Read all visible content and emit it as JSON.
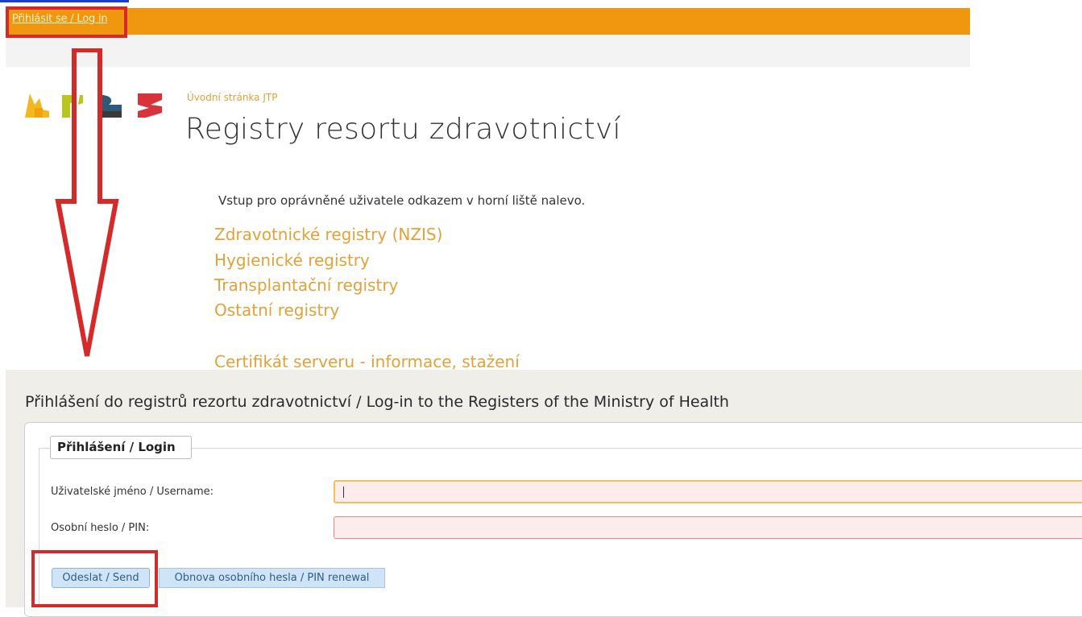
{
  "header": {
    "login_link": "Přihlásit se / Log in"
  },
  "breadcrumb": "Úvodní stránka JTP",
  "page_title": "Registry resortu zdravotnictví",
  "intro_text": "Vstup pro oprávněné uživatele odkazem v horní liště nalevo.",
  "registry_links": [
    "Zdravotnické registry (NZIS)",
    "Hygienické registry",
    "Transplantační registry",
    "Ostatní registry"
  ],
  "certificate_link": "Certifikát serveru - informace, stažení",
  "login_form": {
    "title": "Přihlášení do registrů rezortu zdravotnictví / Log-in to the Registers of the Ministry of Health",
    "legend": "Přihlášení / Login",
    "username_label": "Uživatelské jméno / Username:",
    "username_value": "",
    "pin_label": "Osobní heslo / PIN:",
    "pin_value": "",
    "send_button": "Odeslat / Send",
    "pin_renewal_button": "Obnova osobního hesla / PIN renewal"
  },
  "colors": {
    "topbar": "#f0960f",
    "link": "#e0a23a",
    "annotation": "#d42a2a",
    "button_bg": "#cfe4f6"
  },
  "icons": {
    "logo": "uzis-logo",
    "annotation_arrow": "down-arrow-annotation"
  }
}
